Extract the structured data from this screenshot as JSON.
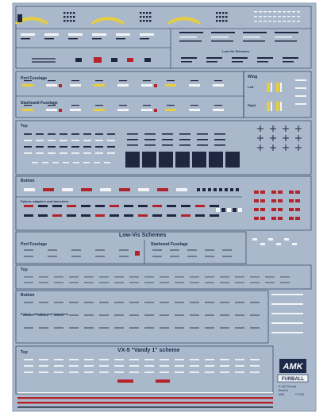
{
  "sheet": {
    "colors": {
      "background": "#aab8cc",
      "frame": "#1c2a4a",
      "decal_dark": "#1f2740",
      "decal_white": "#f2f4f7",
      "decal_yellow": "#e8cf3a",
      "decal_red": "#b3232a",
      "decal_gray": "#6f7c8f"
    },
    "sections": {
      "port_fuselage": "Port Fuselage",
      "starboard_fuselage": "Starboard Fuselage",
      "wing": "Wing",
      "wing_left": "Left",
      "wing_right": "Right",
      "top": "Top",
      "bottom": "Bottom",
      "pylons": "Pylons, adapters and launchers",
      "low_vis_title": "Low-Vis Schemes",
      "low_vis_port": "Port Fuselage",
      "low_vis_starboard": "Starboard Fuselage",
      "low_vis_top": "Top",
      "low_vis_bottom": "Bottom",
      "low_vis_pylons": "Pylons, adapters and launchers",
      "vx9_top": "Top",
      "vx9_title": "VX-9 \"Vandy 1\" scheme",
      "low_vis_header_small": "Low-Vis Schemes"
    },
    "brand": {
      "logo_text": "AMK",
      "banner_text": "FURBALL",
      "info_lines": [
        "F-14D Tomcat",
        "Sheet A",
        "AMK"
      ],
      "copyright": "© 2016"
    }
  }
}
